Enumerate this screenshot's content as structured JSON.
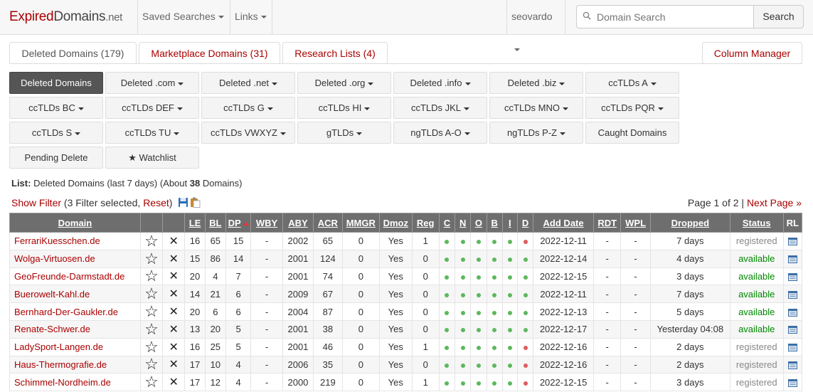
{
  "logo": {
    "red": "Expired",
    "grey": "Domains",
    "tld": ".net"
  },
  "nav": {
    "saved_searches": "Saved Searches",
    "links": "Links",
    "user": "seovardo"
  },
  "search": {
    "placeholder": "Domain Search",
    "button": "Search"
  },
  "tabs": [
    {
      "label": "Deleted Domains (179)"
    },
    {
      "label": "Marketplace Domains (31)"
    },
    {
      "label": "Research Lists (4)"
    }
  ],
  "column_manager": "Column Manager",
  "filter_buttons": [
    {
      "label": "Deleted Domains",
      "caret": false,
      "active": true
    },
    {
      "label": "Deleted .com",
      "caret": true
    },
    {
      "label": "Deleted .net",
      "caret": true
    },
    {
      "label": "Deleted .org",
      "caret": true
    },
    {
      "label": "Deleted .info",
      "caret": true
    },
    {
      "label": "Deleted .biz",
      "caret": true
    },
    {
      "label": "ccTLDs A",
      "caret": true
    },
    {
      "label": "ccTLDs BC",
      "caret": true
    },
    {
      "label": "ccTLDs DEF",
      "caret": true
    },
    {
      "label": "ccTLDs G",
      "caret": true
    },
    {
      "label": "ccTLDs HI",
      "caret": true
    },
    {
      "label": "ccTLDs JKL",
      "caret": true
    },
    {
      "label": "ccTLDs MNO",
      "caret": true
    },
    {
      "label": "ccTLDs PQR",
      "caret": true
    },
    {
      "label": "ccTLDs S",
      "caret": true
    },
    {
      "label": "ccTLDs TU",
      "caret": true
    },
    {
      "label": "ccTLDs VWXYZ",
      "caret": true
    },
    {
      "label": "gTLDs",
      "caret": true
    },
    {
      "label": "ngTLDs A-O",
      "caret": true
    },
    {
      "label": "ngTLDs P-Z",
      "caret": true
    },
    {
      "label": "Caught Domains",
      "caret": false
    },
    {
      "label": "Pending Delete",
      "caret": false
    },
    {
      "label": "★ Watchlist",
      "caret": false
    }
  ],
  "list": {
    "prefix": "List:",
    "text": "Deleted Domains (last 7 days) (About",
    "count": "38",
    "suffix": "Domains)"
  },
  "filter": {
    "show": "Show Filter",
    "selected": "(3 Filter selected,",
    "reset": "Reset",
    "close": ")"
  },
  "pagination": {
    "page": "Page 1 of 2 |",
    "next": "Next Page »"
  },
  "table": {
    "headers": [
      "Domain",
      "",
      "",
      "LE",
      "BL",
      "DP",
      "WBY",
      "ABY",
      "ACR",
      "MMGR",
      "Dmoz",
      "Reg",
      "C",
      "N",
      "O",
      "B",
      "I",
      "D",
      "Add Date",
      "RDT",
      "WPL",
      "Dropped",
      "Status",
      "RL"
    ],
    "rows": [
      {
        "domain": "FerrariKuesschen.de",
        "le": "16",
        "bl": "65",
        "dp": "15",
        "wby": "-",
        "aby": "2002",
        "acr": "65",
        "mmgr": "0",
        "dmoz": "Yes",
        "reg": "1",
        "d": "red",
        "add": "2022-12-11",
        "rdt": "-",
        "wpl": "-",
        "dropped": "7 days",
        "status": "registered"
      },
      {
        "domain": "Wolga-Virtuosen.de",
        "le": "15",
        "bl": "86",
        "dp": "14",
        "wby": "-",
        "aby": "2001",
        "acr": "124",
        "mmgr": "0",
        "dmoz": "Yes",
        "reg": "0",
        "d": "green",
        "add": "2022-12-14",
        "rdt": "-",
        "wpl": "-",
        "dropped": "4 days",
        "status": "available"
      },
      {
        "domain": "GeoFreunde-Darmstadt.de",
        "le": "20",
        "bl": "4",
        "dp": "7",
        "wby": "-",
        "aby": "2001",
        "acr": "74",
        "mmgr": "0",
        "dmoz": "Yes",
        "reg": "0",
        "d": "green",
        "add": "2022-12-15",
        "rdt": "-",
        "wpl": "-",
        "dropped": "3 days",
        "status": "available"
      },
      {
        "domain": "Buerowelt-Kahl.de",
        "le": "14",
        "bl": "21",
        "dp": "6",
        "wby": "-",
        "aby": "2009",
        "acr": "67",
        "mmgr": "0",
        "dmoz": "Yes",
        "reg": "0",
        "d": "green",
        "add": "2022-12-11",
        "rdt": "-",
        "wpl": "-",
        "dropped": "7 days",
        "status": "available"
      },
      {
        "domain": "Bernhard-Der-Gaukler.de",
        "le": "20",
        "bl": "6",
        "dp": "6",
        "wby": "-",
        "aby": "2004",
        "acr": "87",
        "mmgr": "0",
        "dmoz": "Yes",
        "reg": "0",
        "d": "green",
        "add": "2022-12-13",
        "rdt": "-",
        "wpl": "-",
        "dropped": "5 days",
        "status": "available"
      },
      {
        "domain": "Renate-Schwer.de",
        "le": "13",
        "bl": "20",
        "dp": "5",
        "wby": "-",
        "aby": "2001",
        "acr": "38",
        "mmgr": "0",
        "dmoz": "Yes",
        "reg": "0",
        "d": "green",
        "add": "2022-12-17",
        "rdt": "-",
        "wpl": "-",
        "dropped": "Yesterday 04:08",
        "status": "available"
      },
      {
        "domain": "LadySport-Langen.de",
        "le": "16",
        "bl": "25",
        "dp": "5",
        "wby": "-",
        "aby": "2001",
        "acr": "46",
        "mmgr": "0",
        "dmoz": "Yes",
        "reg": "1",
        "d": "red",
        "add": "2022-12-16",
        "rdt": "-",
        "wpl": "-",
        "dropped": "2 days",
        "status": "registered"
      },
      {
        "domain": "Haus-Thermografie.de",
        "le": "17",
        "bl": "10",
        "dp": "4",
        "wby": "-",
        "aby": "2006",
        "acr": "35",
        "mmgr": "0",
        "dmoz": "Yes",
        "reg": "0",
        "d": "red",
        "add": "2022-12-16",
        "rdt": "-",
        "wpl": "-",
        "dropped": "2 days",
        "status": "registered"
      },
      {
        "domain": "Schimmel-Nordheim.de",
        "le": "17",
        "bl": "12",
        "dp": "4",
        "wby": "-",
        "aby": "2000",
        "acr": "219",
        "mmgr": "0",
        "dmoz": "Yes",
        "reg": "1",
        "d": "red",
        "add": "2022-12-15",
        "rdt": "-",
        "wpl": "-",
        "dropped": "3 days",
        "status": "registered"
      }
    ]
  },
  "colors": {
    "accent": "#aa0000",
    "green_dot": "#5cb85c",
    "red_dot": "#e05c5c",
    "header_bg": "#6e6e6e",
    "available": "#008800"
  }
}
